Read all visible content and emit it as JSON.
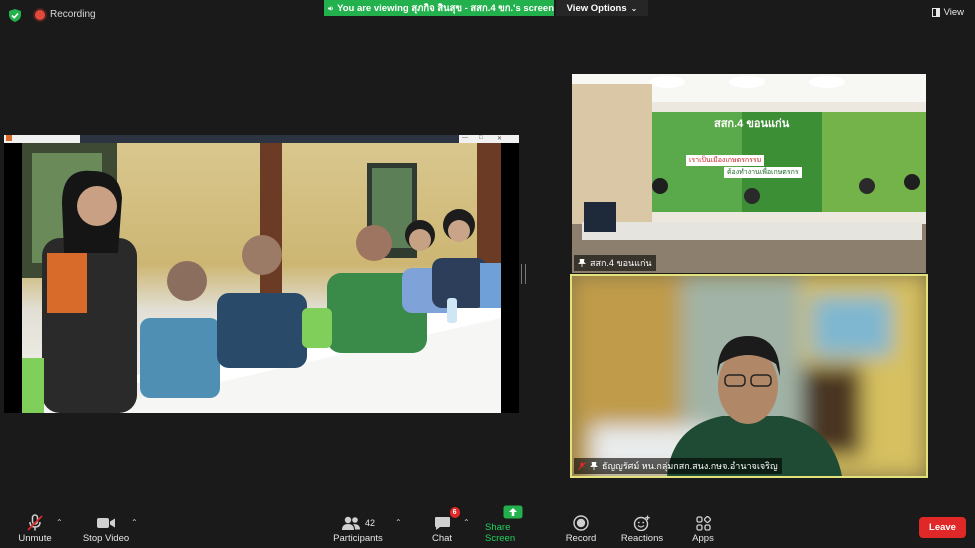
{
  "top_bar": {
    "recording_label": "Recording",
    "share_banner": "You are viewing สุภกิจ สินสุข - สสก.4 ขก.'s screen",
    "view_options_label": "View Options",
    "view_label": "View"
  },
  "videos": [
    {
      "name": "สสก.4 ขอนแก่น"
    },
    {
      "name": "ธัญญรัศม์ หน.กลุ่มกสก.สนง.กษจ.อำนาจเจริญ"
    }
  ],
  "scene_banner": {
    "title": "สสก.4 ขอนแก่น",
    "line1": "เราเป็นเมืองเกษตรกรรม",
    "line2": "ต้องทำงานเพื่อเกษตรกร"
  },
  "toolbar": {
    "unmute": "Unmute",
    "stop_video": "Stop Video",
    "participants": "Participants",
    "participants_count": "42",
    "chat": "Chat",
    "chat_badge": "6",
    "share_screen": "Share Screen",
    "record": "Record",
    "reactions": "Reactions",
    "apps": "Apps",
    "leave": "Leave"
  },
  "colors": {
    "share_green": "#23b14d",
    "leave_red": "#e02828",
    "active_border": "#e4e27c",
    "recording_red": "#e34a3b"
  }
}
